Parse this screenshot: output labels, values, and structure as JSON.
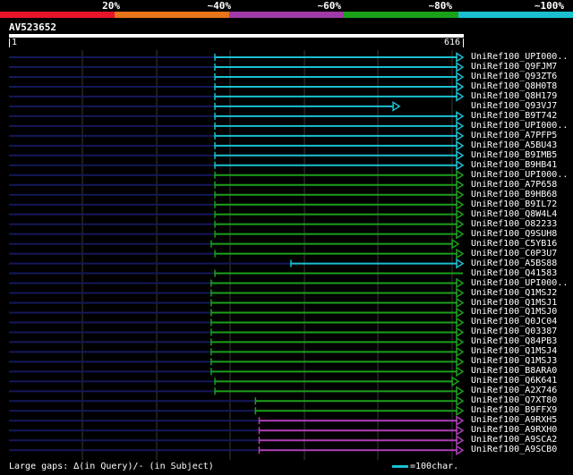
{
  "legend": {
    "labels": [
      "20%",
      "~40%",
      "~60%",
      "~80%",
      "~100%"
    ],
    "colors": [
      "#e8142c",
      "#e8751a",
      "#a03aa8",
      "#1aa01a",
      "#19c0d0"
    ]
  },
  "query": {
    "name": "AV523652",
    "start": "1",
    "end": "616",
    "length": 616
  },
  "hits": [
    {
      "label": "UniRef100_UPI000..",
      "start": 280,
      "end": 616,
      "color": "cyan",
      "arrow": true
    },
    {
      "label": "UniRef100_Q9FJM7",
      "start": 280,
      "end": 616,
      "color": "cyan",
      "arrow": true
    },
    {
      "label": "UniRef100_Q93ZT6",
      "start": 280,
      "end": 616,
      "color": "cyan",
      "arrow": true
    },
    {
      "label": "UniRef100_Q8H0T8",
      "start": 280,
      "end": 616,
      "color": "cyan",
      "arrow": true
    },
    {
      "label": "UniRef100_Q8H179",
      "start": 280,
      "end": 616,
      "color": "cyan",
      "arrow": true
    },
    {
      "label": "UniRef100_Q93VJ7",
      "start": 280,
      "end": 530,
      "color": "cyan",
      "arrow": true
    },
    {
      "label": "UniRef100_B9T742",
      "start": 280,
      "end": 616,
      "color": "cyan",
      "arrow": true
    },
    {
      "label": "UniRef100_UPI000..",
      "start": 280,
      "end": 616,
      "color": "cyan",
      "arrow": true
    },
    {
      "label": "UniRef100_A7PFP5",
      "start": 280,
      "end": 616,
      "color": "cyan",
      "arrow": true
    },
    {
      "label": "UniRef100_A5BU43",
      "start": 280,
      "end": 616,
      "color": "cyan",
      "arrow": true
    },
    {
      "label": "UniRef100_B9IMB5",
      "start": 280,
      "end": 616,
      "color": "cyan",
      "arrow": true
    },
    {
      "label": "UniRef100_B9HB41",
      "start": 280,
      "end": 616,
      "color": "cyan",
      "arrow": true
    },
    {
      "label": "UniRef100_UPI000..",
      "start": 280,
      "end": 616,
      "color": "green",
      "arrow": true
    },
    {
      "label": "UniRef100_A7P658",
      "start": 280,
      "end": 616,
      "color": "green",
      "arrow": true
    },
    {
      "label": "UniRef100_B9HB68",
      "start": 280,
      "end": 616,
      "color": "green",
      "arrow": true
    },
    {
      "label": "UniRef100_B9IL72",
      "start": 280,
      "end": 616,
      "color": "green",
      "arrow": true
    },
    {
      "label": "UniRef100_Q8W4L4",
      "start": 280,
      "end": 616,
      "color": "green",
      "arrow": true
    },
    {
      "label": "UniRef100_O82233",
      "start": 280,
      "end": 616,
      "color": "green",
      "arrow": true
    },
    {
      "label": "UniRef100_Q9SUH8",
      "start": 280,
      "end": 616,
      "color": "green",
      "arrow": true
    },
    {
      "label": "UniRef100_C5YB16",
      "start": 275,
      "end": 610,
      "color": "green",
      "arrow": true
    },
    {
      "label": "UniRef100_C0P3U7",
      "start": 280,
      "end": 616,
      "color": "green",
      "arrow": true
    },
    {
      "label": "UniRef100_A5BS88",
      "start": 383,
      "end": 616,
      "color": "cyan",
      "arrow": true
    },
    {
      "label": "UniRef100_Q41583",
      "start": 280,
      "end": 616,
      "color": "green",
      "arrow": false
    },
    {
      "label": "UniRef100_UPI000..",
      "start": 275,
      "end": 616,
      "color": "green",
      "arrow": true
    },
    {
      "label": "UniRef100_Q1MSJ2",
      "start": 275,
      "end": 616,
      "color": "green",
      "arrow": true
    },
    {
      "label": "UniRef100_Q1MSJ1",
      "start": 275,
      "end": 616,
      "color": "green",
      "arrow": true
    },
    {
      "label": "UniRef100_Q1MSJ0",
      "start": 275,
      "end": 616,
      "color": "green",
      "arrow": true
    },
    {
      "label": "UniRef100_Q0JC04",
      "start": 275,
      "end": 616,
      "color": "green",
      "arrow": true
    },
    {
      "label": "UniRef100_Q03387",
      "start": 275,
      "end": 616,
      "color": "green",
      "arrow": true
    },
    {
      "label": "UniRef100_Q84PB3",
      "start": 275,
      "end": 616,
      "color": "green",
      "arrow": true
    },
    {
      "label": "UniRef100_Q1MSJ4",
      "start": 275,
      "end": 616,
      "color": "green",
      "arrow": true
    },
    {
      "label": "UniRef100_Q1MSJ3",
      "start": 275,
      "end": 616,
      "color": "green",
      "arrow": true
    },
    {
      "label": "UniRef100_B8ARA0",
      "start": 275,
      "end": 616,
      "color": "green",
      "arrow": true
    },
    {
      "label": "UniRef100_Q6K641",
      "start": 280,
      "end": 610,
      "color": "green",
      "arrow": true
    },
    {
      "label": "UniRef100_A2X746",
      "start": 280,
      "end": 616,
      "color": "green",
      "arrow": true
    },
    {
      "label": "UniRef100_Q7XT80",
      "start": 335,
      "end": 616,
      "color": "green",
      "arrow": true
    },
    {
      "label": "UniRef100_B9FFX9",
      "start": 335,
      "end": 616,
      "color": "green",
      "arrow": true
    },
    {
      "label": "UniRef100_A9RXH5",
      "start": 340,
      "end": 616,
      "color": "purple",
      "arrow": true
    },
    {
      "label": "UniRef100_A9RXH0",
      "start": 340,
      "end": 616,
      "color": "purple",
      "arrow": true
    },
    {
      "label": "UniRef100_A9SCA2",
      "start": 340,
      "end": 616,
      "color": "purple",
      "arrow": true
    },
    {
      "label": "UniRef100_A9SCB0",
      "start": 340,
      "end": 616,
      "color": "purple",
      "arrow": true
    }
  ],
  "footer": {
    "gaps_text": "Large gaps: ∆(in Query)/- (in Subject)",
    "scale_text": "=100char."
  }
}
